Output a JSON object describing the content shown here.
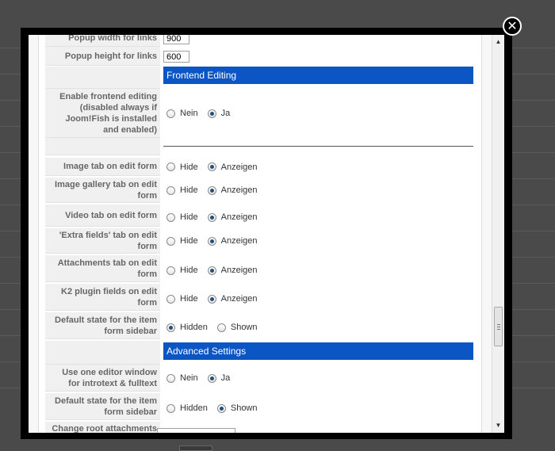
{
  "close_glyph": "✕",
  "scrollbar": {
    "up_glyph": "▲",
    "down_glyph": "▼"
  },
  "rows_top": [
    {
      "label": "Popup width for links",
      "value": "900"
    },
    {
      "label": "Popup height for links",
      "value": "600"
    }
  ],
  "section_frontend": "Frontend Editing",
  "frontend_editing": {
    "label": "Enable frontend editing (disabled always if Joom!Fish is installed and enabled)",
    "options": [
      "Nein",
      "Ja"
    ],
    "selected": "Ja"
  },
  "tab_rows": [
    {
      "label": "Image tab on edit form",
      "options": [
        "Hide",
        "Anzeigen"
      ],
      "selected": "Anzeigen"
    },
    {
      "label": "Image gallery tab on edit form",
      "options": [
        "Hide",
        "Anzeigen"
      ],
      "selected": "Anzeigen"
    },
    {
      "label": "Video tab on edit form",
      "options": [
        "Hide",
        "Anzeigen"
      ],
      "selected": "Anzeigen"
    },
    {
      "label": "'Extra fields' tab on edit form",
      "options": [
        "Hide",
        "Anzeigen"
      ],
      "selected": "Anzeigen"
    },
    {
      "label": "Attachments tab on edit form",
      "options": [
        "Hide",
        "Anzeigen"
      ],
      "selected": "Anzeigen"
    },
    {
      "label": "K2 plugin fields on edit form",
      "options": [
        "Hide",
        "Anzeigen"
      ],
      "selected": "Anzeigen"
    },
    {
      "label": "Default state for the item form sidebar",
      "options": [
        "Hidden",
        "Shown"
      ],
      "selected": "Hidden"
    }
  ],
  "section_advanced": "Advanced Settings",
  "advanced_rows": [
    {
      "label": "Use one editor window for introtext & fulltext",
      "options": [
        "Nein",
        "Ja"
      ],
      "selected": "Ja"
    },
    {
      "label": "Default state for the item form sidebar",
      "options": [
        "Hidden",
        "Shown"
      ],
      "selected": "Shown"
    }
  ],
  "cut_row_label": "Change root attachments"
}
